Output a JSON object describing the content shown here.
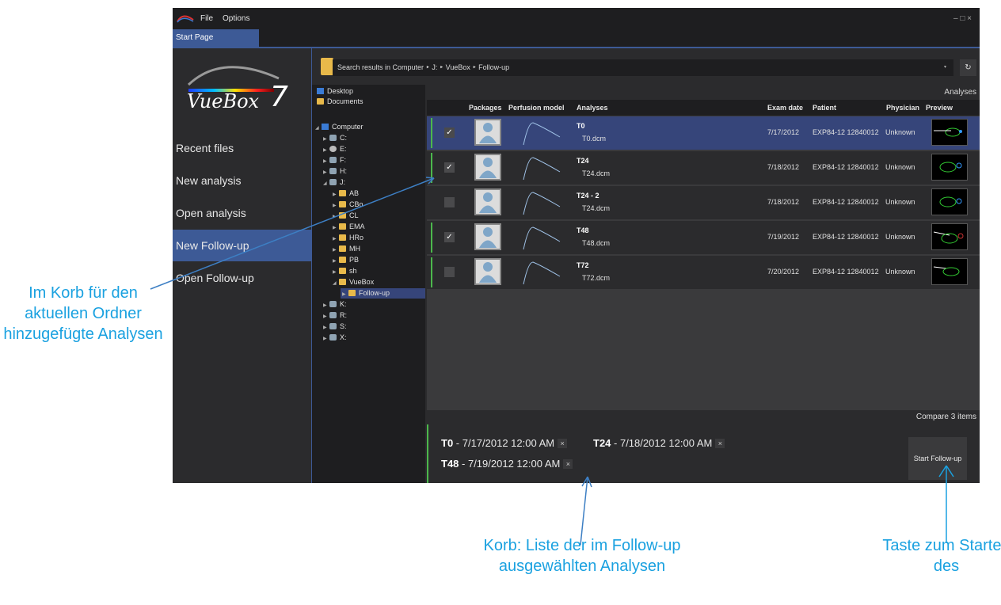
{
  "window": {
    "menu": [
      "File",
      "Options"
    ],
    "controls": "– □ ×",
    "tab": "Start Page"
  },
  "logo": {
    "text": "VueBox",
    "version": "7"
  },
  "nav": [
    {
      "label": "Recent files"
    },
    {
      "label": "New analysis"
    },
    {
      "label": "Open analysis"
    },
    {
      "label": "New Follow-up",
      "active": true
    },
    {
      "label": "Open Follow-up"
    }
  ],
  "address": {
    "text": "Search results in Computer  ‣  J:  ‣  VueBox  ‣  Follow-up",
    "refresh": "↻"
  },
  "tree": {
    "favorites": [
      "Desktop",
      "Documents"
    ],
    "computer": "Computer",
    "drives": [
      "C:",
      "E:",
      "F:",
      "H:",
      "J:"
    ],
    "j_folders": [
      "AB",
      "CBo",
      "CL",
      "EMA",
      "HRo",
      "MH",
      "PB",
      "sh",
      "VueBox"
    ],
    "vuebox_child": "Follow-up",
    "more_drives": [
      "K:",
      "R:",
      "S:",
      "X:"
    ]
  },
  "content": {
    "section_title": "Analyses",
    "columns": {
      "packages": "Packages",
      "perfusion": "Perfusion model",
      "analyses": "Analyses",
      "exam_date": "Exam date",
      "patient": "Patient",
      "physician": "Physician",
      "preview": "Preview"
    },
    "rows": [
      {
        "name": "T0",
        "file": "T0.dcm",
        "checked": "✓",
        "date": "7/17/2012",
        "patient": "EXP84-12 12840012",
        "physician": "Unknown"
      },
      {
        "name": "T24",
        "file": "T24.dcm",
        "checked": "✓",
        "date": "7/18/2012",
        "patient": "EXP84-12 12840012",
        "physician": "Unknown"
      },
      {
        "name": "T24 - 2",
        "file": "T24.dcm",
        "checked": "",
        "date": "7/18/2012",
        "patient": "EXP84-12 12840012",
        "physician": "Unknown"
      },
      {
        "name": "T48",
        "file": "T48.dcm",
        "checked": "✓",
        "date": "7/19/2012",
        "patient": "EXP84-12 12840012",
        "physician": "Unknown"
      },
      {
        "name": "T72",
        "file": "T72.dcm",
        "checked": "",
        "date": "7/20/2012",
        "patient": "EXP84-12 12840012",
        "physician": "Unknown"
      }
    ],
    "compare": "Compare 3 items",
    "basket": [
      {
        "name": "T0",
        "date": " - 7/17/2012 12:00 AM"
      },
      {
        "name": "T24",
        "date": " - 7/18/2012 12:00 AM"
      },
      {
        "name": "T48",
        "date": " - 7/19/2012 12:00 AM"
      }
    ],
    "remove": "×",
    "start_button": "Start Follow-up"
  },
  "annotations": {
    "left": "Im Korb für den aktuellen Ordner hinzugefügte Analysen",
    "bottom": "Korb: Liste der im Follow-up ausgewählten Analysen",
    "right": "Taste zum Starten des"
  },
  "colors": {
    "accent": "#3d5a96",
    "green": "#4cb84c",
    "annotation": "#1aa1e0"
  }
}
